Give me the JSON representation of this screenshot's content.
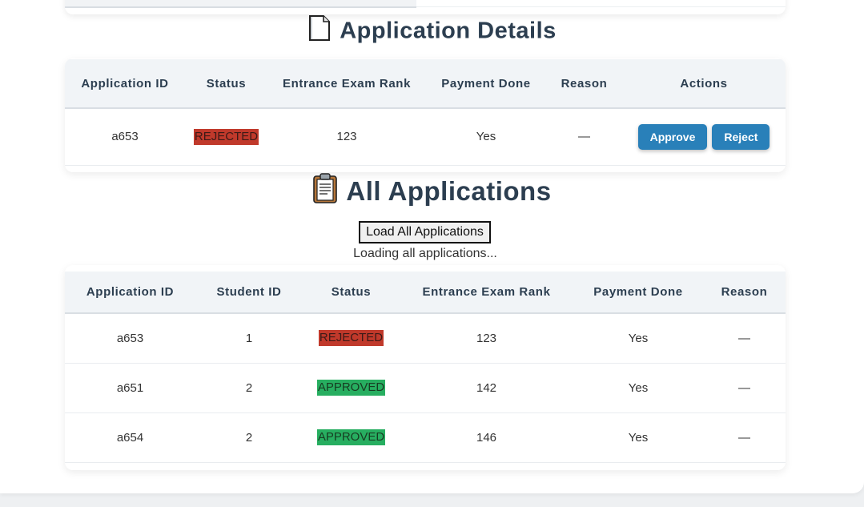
{
  "details": {
    "title": "Application Details",
    "icon": "page-icon",
    "columns": [
      "Application ID",
      "Status",
      "Entrance Exam Rank",
      "Payment Done",
      "Reason",
      "Actions"
    ],
    "row": {
      "application_id": "a653",
      "status": "REJECTED",
      "rank": "123",
      "payment_done": "Yes",
      "reason": "—"
    },
    "approve_label": "Approve",
    "reject_label": "Reject"
  },
  "all": {
    "title": "All Applications",
    "icon": "clipboard-icon",
    "load_button": "Load All Applications",
    "loading_text": "Loading all applications...",
    "columns": [
      "Application ID",
      "Student ID",
      "Status",
      "Entrance Exam Rank",
      "Payment Done",
      "Reason"
    ],
    "rows": [
      {
        "application_id": "a653",
        "student_id": "1",
        "status": "REJECTED",
        "rank": "123",
        "payment_done": "Yes",
        "reason": "—"
      },
      {
        "application_id": "a651",
        "student_id": "2",
        "status": "APPROVED",
        "rank": "142",
        "payment_done": "Yes",
        "reason": "—"
      },
      {
        "application_id": "a654",
        "student_id": "2",
        "status": "APPROVED",
        "rank": "146",
        "payment_done": "Yes",
        "reason": "—"
      }
    ]
  },
  "colors": {
    "rejected": "#c0392b",
    "approved": "#27ae60",
    "button": "#2980b9",
    "heading": "#2c3e50"
  }
}
